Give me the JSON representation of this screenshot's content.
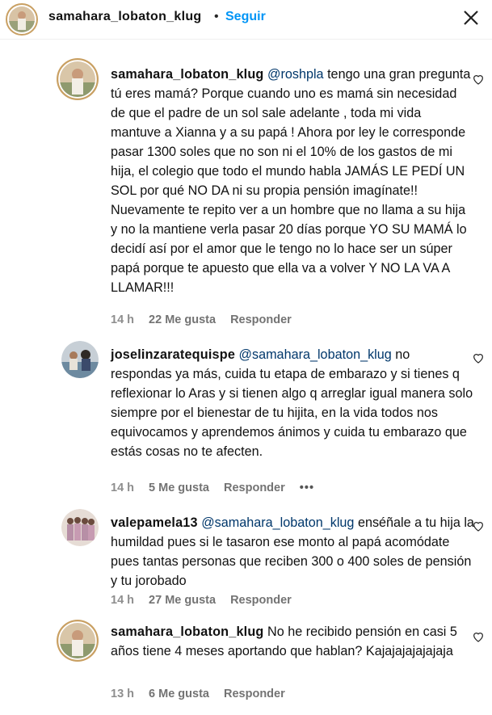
{
  "header": {
    "username": "samahara_lobaton_klug",
    "separator": "•",
    "follow_label": "Seguir"
  },
  "comments": [
    {
      "username": "samahara_lobaton_klug",
      "mention": "@roshpla",
      "text": "tengo una gran pregunta tú eres mamá? Porque cuando uno es mamá sin necesidad de que el padre de un sol sale adelante , toda mi vida mantuve a Xianna y a su papá ! Ahora por ley le corresponde pasar 1300 soles que no son ni el 10% de los gastos de mi hija, el colegio que todo el mundo habla JAMÁS LE PEDÍ UN SOL por qué NO DA ni su propia pensión imagínate!! Nuevamente te repito ver a un hombre que no llama a su hija y no la mantiene verla pasar 20 días porque YO SU MAMÁ lo decidí así por el amor que le tengo no lo hace ser un súper papá porque te apuesto que ella va a volver Y NO LA VA A LLAMAR!!!",
      "time": "14 h",
      "likes": "22 Me gusta",
      "reply": "Responder",
      "extra": ""
    },
    {
      "username": "joselinzaratequispe",
      "mention": "@samahara_lobaton_klug",
      "text": "no respondas ya más, cuida tu etapa de embarazo y si tienes q reflexionar lo Aras y si tienen algo q arreglar igual manera solo siempre por el bienestar de tu hijita, en la vida todos nos equivocamos y aprendemos ánimos y cuida tu embarazo que estás cosas no te afecten.",
      "time": "14 h",
      "likes": "5 Me gusta",
      "reply": "Responder",
      "extra": "•••"
    },
    {
      "username": "valepamela13",
      "mention": "@samahara_lobaton_klug",
      "text": "enséñale a tu hija la humildad pues si le tasaron ese monto al papá acomódate pues tantas personas que reciben 300 o 400 soles de pensión y tu jorobado",
      "time": "14 h",
      "likes": "27 Me gusta",
      "reply": "Responder",
      "extra": ""
    },
    {
      "username": "samahara_lobaton_klug",
      "mention": "",
      "text": "No he recibido pensión en casi 5 años tiene 4 meses aportando que hablan? Kajajajajajajaja",
      "time": "13 h",
      "likes": "6 Me gusta",
      "reply": "Responder",
      "extra": ""
    }
  ],
  "icons": {
    "more": "more-options-icon",
    "like": "heart-icon"
  }
}
